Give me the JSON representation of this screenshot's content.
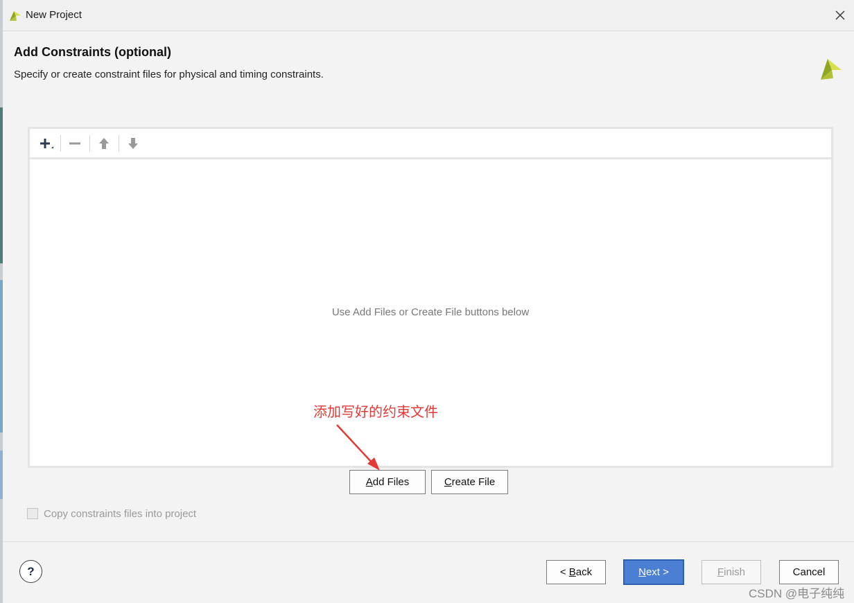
{
  "window": {
    "title": "New Project"
  },
  "header": {
    "title": "Add Constraints (optional)",
    "subtitle": "Specify or create constraint files for physical and timing constraints."
  },
  "file_list": {
    "empty_hint": "Use Add Files or Create File buttons below"
  },
  "annotation": {
    "text": "添加写好的约束文件",
    "color": "#e53935"
  },
  "actions": {
    "add_files_mnemonic": "A",
    "add_files_rest": "dd Files",
    "create_file_mnemonic": "C",
    "create_file_rest": "reate File"
  },
  "options": {
    "copy_label": "Copy constraints files into project",
    "copy_checked": false,
    "copy_enabled": false
  },
  "footer": {
    "help_label": "?",
    "back_prefix": "< ",
    "back_mnemonic": "B",
    "back_rest": "ack",
    "next_mnemonic": "N",
    "next_rest": "ext >",
    "finish_mnemonic": "F",
    "finish_rest": "inish",
    "cancel_label": "Cancel"
  },
  "watermark": "CSDN @电子纯纯",
  "colors": {
    "accent": "#4a7fd4",
    "logo_green": "#8fa61f",
    "logo_yellow": "#d9e04f"
  },
  "icons": [
    "xilinx-logo-icon",
    "close-icon",
    "add-icon",
    "remove-icon",
    "move-up-icon",
    "move-down-icon",
    "help-icon"
  ]
}
